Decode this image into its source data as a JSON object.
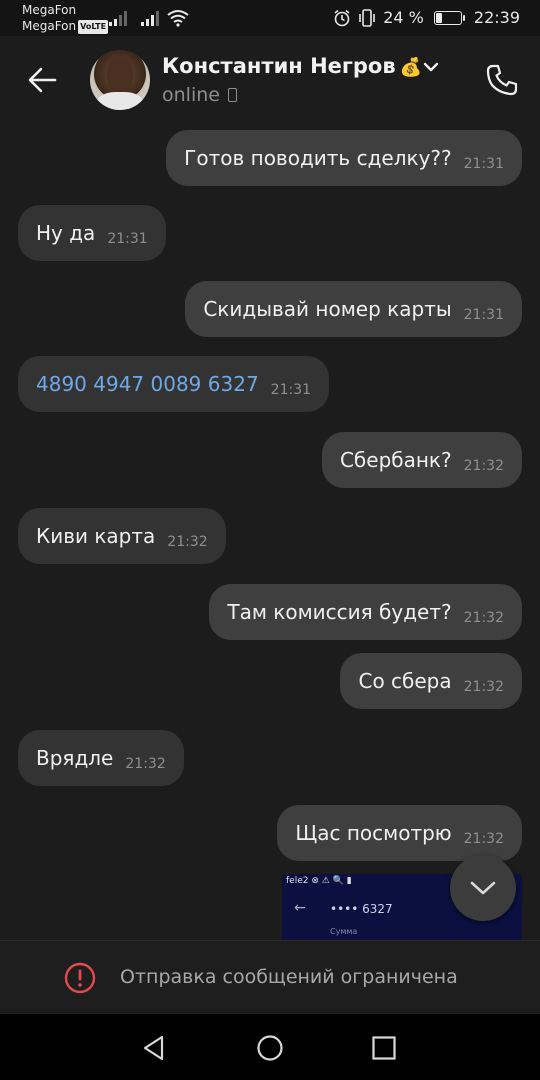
{
  "status_bar": {
    "carrier_1": "MegaFon",
    "carrier_2": "MegaFon",
    "volte_label": "VoLTE",
    "battery_text": "24 %",
    "battery_level": 0.24,
    "time": "22:39",
    "icons": [
      "signal-icon",
      "wifi-icon",
      "alarm-icon",
      "vibrate-icon",
      "battery-icon"
    ]
  },
  "header": {
    "back_icon": "arrow-left-icon",
    "contact_name": "Константин Негров",
    "contact_emoji": "💰",
    "status": "online",
    "status_icon": "mobile-device-icon",
    "call_icon": "phone-icon"
  },
  "messages": [
    {
      "direction": "out",
      "text": "Готов поводить сделку??",
      "time": "21:31"
    },
    {
      "direction": "in",
      "text": "Ну да",
      "time": "21:31"
    },
    {
      "direction": "out",
      "text": "Скидывай номер карты",
      "time": "21:31"
    },
    {
      "direction": "in",
      "text": "4890 4947 0089 6327",
      "time": "21:31",
      "is_link": true
    },
    {
      "direction": "out",
      "text": "Сбербанк?",
      "time": "21:32"
    },
    {
      "direction": "in",
      "text": "Киви карта",
      "time": "21:32"
    },
    {
      "direction": "out",
      "text": "Там комиссия будет?",
      "time": "21:32"
    },
    {
      "direction": "out",
      "text": "Со сбера",
      "time": "21:32"
    },
    {
      "direction": "in",
      "text": "Врядле",
      "time": "21:32"
    },
    {
      "direction": "out",
      "text": "Щас посмотрю",
      "time": "21:32"
    }
  ],
  "image_preview": {
    "status_text": "fele2 ⊗ ⚠ 🔍 ▮",
    "card_text": "•••• 6327",
    "label": "Сумма"
  },
  "restricted": {
    "text": "Отправка сообщений ограничена",
    "icon": "warning-circle-icon",
    "accent": "#e5484d"
  },
  "nav": {
    "back": "nav-back-icon",
    "home": "nav-home-icon",
    "recents": "nav-recents-icon"
  }
}
